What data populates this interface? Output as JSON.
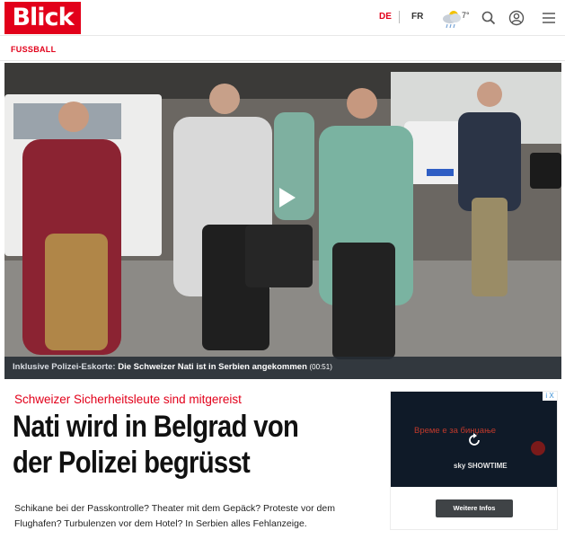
{
  "header": {
    "logo_text": "Blick",
    "lang_de": "DE",
    "lang_fr": "FR",
    "weather_temp": "7°",
    "icons": [
      "weather-icon",
      "search-icon",
      "account-icon",
      "menu-icon"
    ]
  },
  "section": {
    "label": "FUSSBALL"
  },
  "video": {
    "caption_prefix": "Inklusive Polizei-Eskorte:",
    "caption_title": "Die Schweizer Nati ist in Serbien angekommen",
    "caption_duration": "(00:51)"
  },
  "article": {
    "kicker": "Schweizer Sicherheitsleute sind mitgereist",
    "headline_line1": "Nati wird in Belgrad von",
    "headline_line2": "der Polizei begrüsst",
    "lead_line1": "Schikane bei der Passkontrolle? Theater mit dem Gepäck? Proteste vor dem",
    "lead_line2": "Flughafen? Turbulenzen vor dem Hotel? In Serbien alles Fehlanzeige."
  },
  "ad": {
    "title": "Време е за бинџање",
    "brand": "sky SHOWTIME",
    "button_label": "Weitere Infos",
    "choices_label": "i X"
  },
  "colors": {
    "brand_red": "#e2001a",
    "caption_bg": "#262c34",
    "ad_dark": "#0f1a28"
  }
}
